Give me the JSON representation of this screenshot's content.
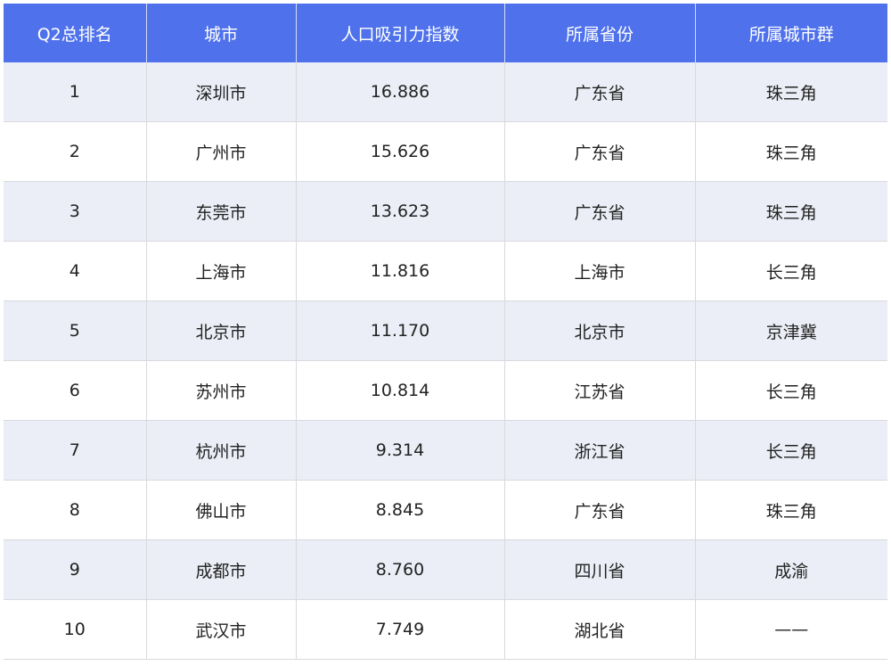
{
  "table": {
    "headers": [
      "Q2总排名",
      "城市",
      "人口吸引力指数",
      "所属省份",
      "所属城市群"
    ],
    "rows": [
      [
        "1",
        "深圳市",
        "16.886",
        "广东省",
        "珠三角"
      ],
      [
        "2",
        "广州市",
        "15.626",
        "广东省",
        "珠三角"
      ],
      [
        "3",
        "东莞市",
        "13.623",
        "广东省",
        "珠三角"
      ],
      [
        "4",
        "上海市",
        "11.816",
        "上海市",
        "长三角"
      ],
      [
        "5",
        "北京市",
        "11.170",
        "北京市",
        "京津冀"
      ],
      [
        "6",
        "苏州市",
        "10.814",
        "江苏省",
        "长三角"
      ],
      [
        "7",
        "杭州市",
        "9.314",
        "浙江省",
        "长三角"
      ],
      [
        "8",
        "佛山市",
        "8.845",
        "广东省",
        "珠三角"
      ],
      [
        "9",
        "成都市",
        "8.760",
        "四川省",
        "成渝"
      ],
      [
        "10",
        "武汉市",
        "7.749",
        "湖北省",
        "——"
      ]
    ]
  },
  "colors": {
    "header_bg": "#4f72ec",
    "header_text": "#ffffff",
    "row_stripe": "#ebeef6",
    "row_plain": "#ffffff",
    "grid": "#d9d9de"
  }
}
